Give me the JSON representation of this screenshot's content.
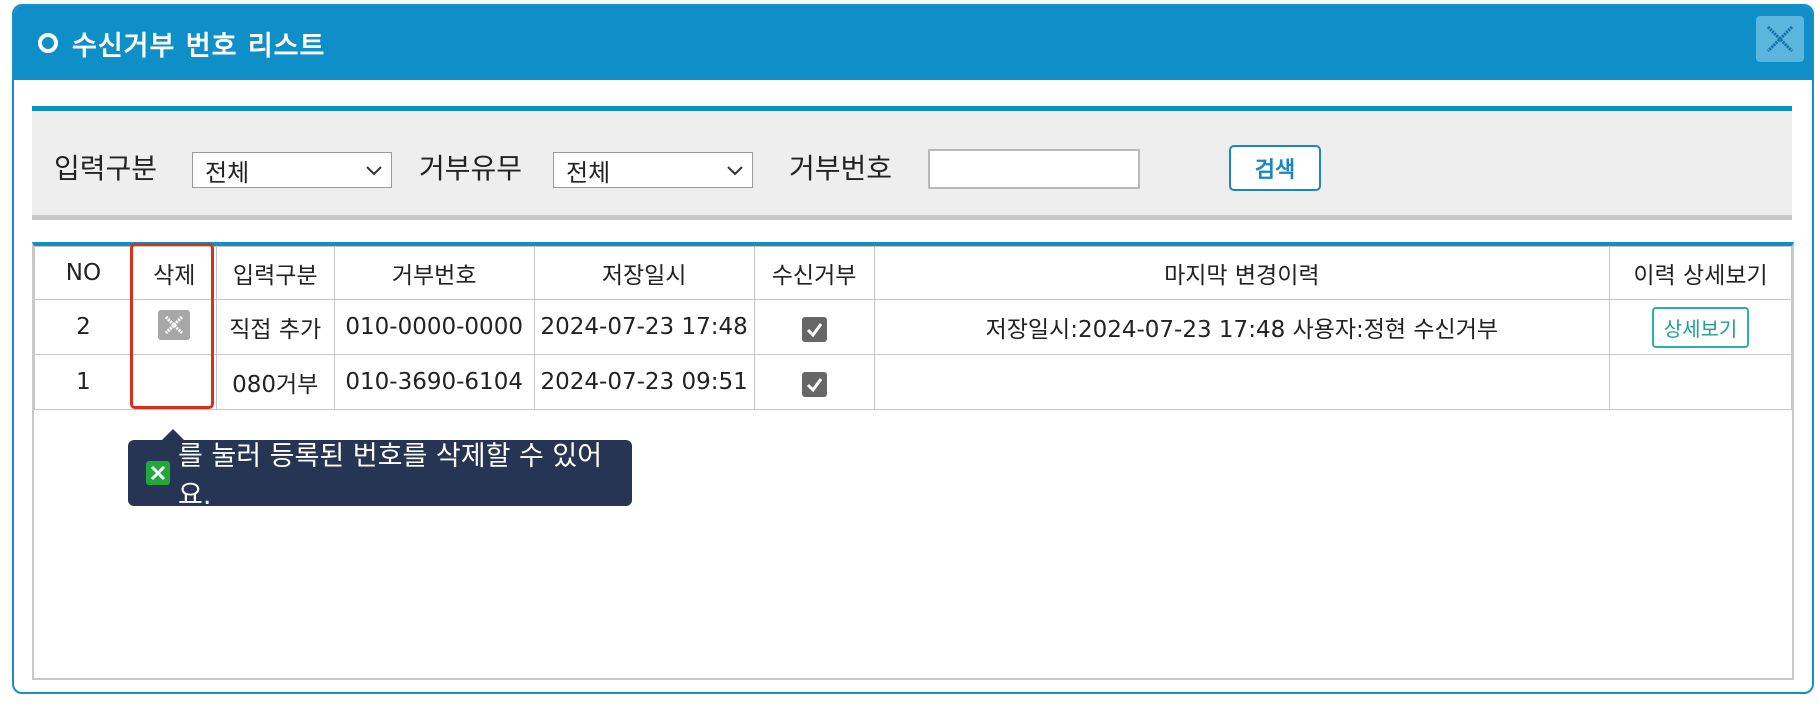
{
  "dialog": {
    "title": "수신거부 번호 리스트",
    "close_icon": "close-icon"
  },
  "search": {
    "input_type_label": "입력구분",
    "input_type_value": "전체",
    "reject_yn_label": "거부유무",
    "reject_yn_value": "전체",
    "reject_number_label": "거부번호",
    "reject_number_value": "",
    "search_button": "검색"
  },
  "table": {
    "headers": [
      "NO",
      "삭제",
      "입력구분",
      "거부번호",
      "저장일시",
      "수신거부",
      "마지막 변경이력",
      "이력 상세보기"
    ],
    "rows": [
      {
        "no": "2",
        "has_delete": true,
        "input_type": "직접 추가",
        "number": "010-0000-0000",
        "saved_at": "2024-07-23 17:48",
        "rejected": true,
        "last_change": "저장일시:2024-07-23 17:48 사용자:정현 수신거부",
        "detail_label": "상세보기"
      },
      {
        "no": "1",
        "has_delete": false,
        "input_type": "080거부",
        "number": "010-3690-6104",
        "saved_at": "2024-07-23 09:51",
        "rejected": true,
        "last_change": "",
        "detail_label": ""
      }
    ]
  },
  "tooltip": {
    "text": "를 눌러 등록된 번호를 삭제할 수 있어요."
  },
  "colors": {
    "header_blue": "#0e8fc8",
    "highlight_red": "#d8301a",
    "tooltip_bg": "#263553",
    "detail_teal": "#2bb0a6"
  }
}
